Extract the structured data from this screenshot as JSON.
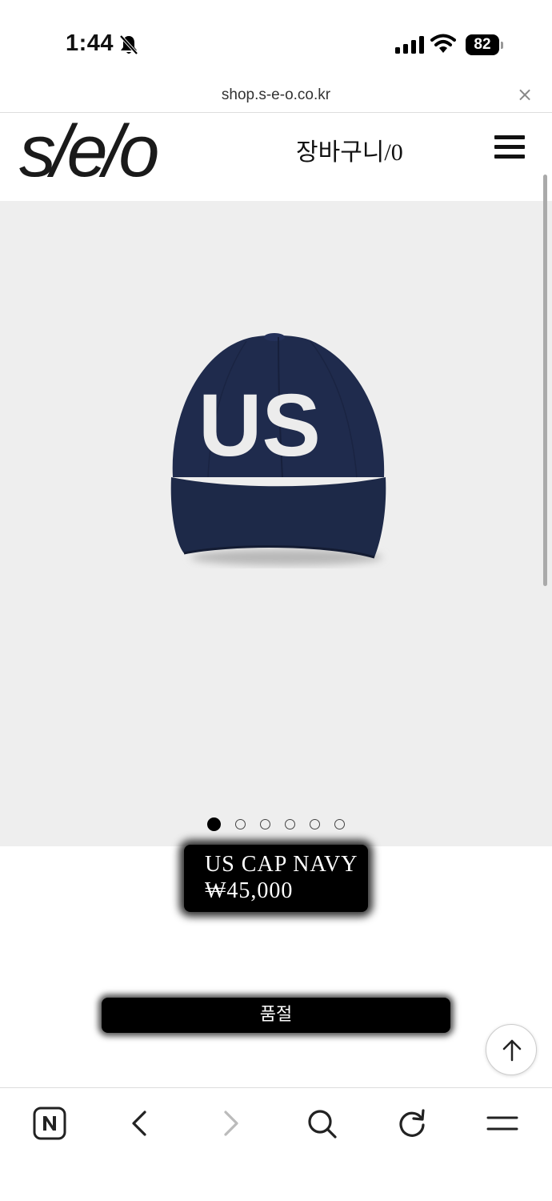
{
  "status_bar": {
    "time": "1:44",
    "battery": "82"
  },
  "browser": {
    "url": "shop.s-e-o.co.kr",
    "close_label": "×"
  },
  "header": {
    "logo": "s/e/o",
    "cart_label": "장바구니/0"
  },
  "product": {
    "name": "US CAP NAVY",
    "price": "₩45,000",
    "cap_lettering": "US",
    "cap_color": "#1f2b4d",
    "image_count": 6,
    "active_image": 1,
    "soldout_label": "품절"
  },
  "toolbar": {
    "icons": [
      "naver-icon",
      "back-icon",
      "forward-icon",
      "search-icon",
      "refresh-icon",
      "menu-icon"
    ]
  }
}
